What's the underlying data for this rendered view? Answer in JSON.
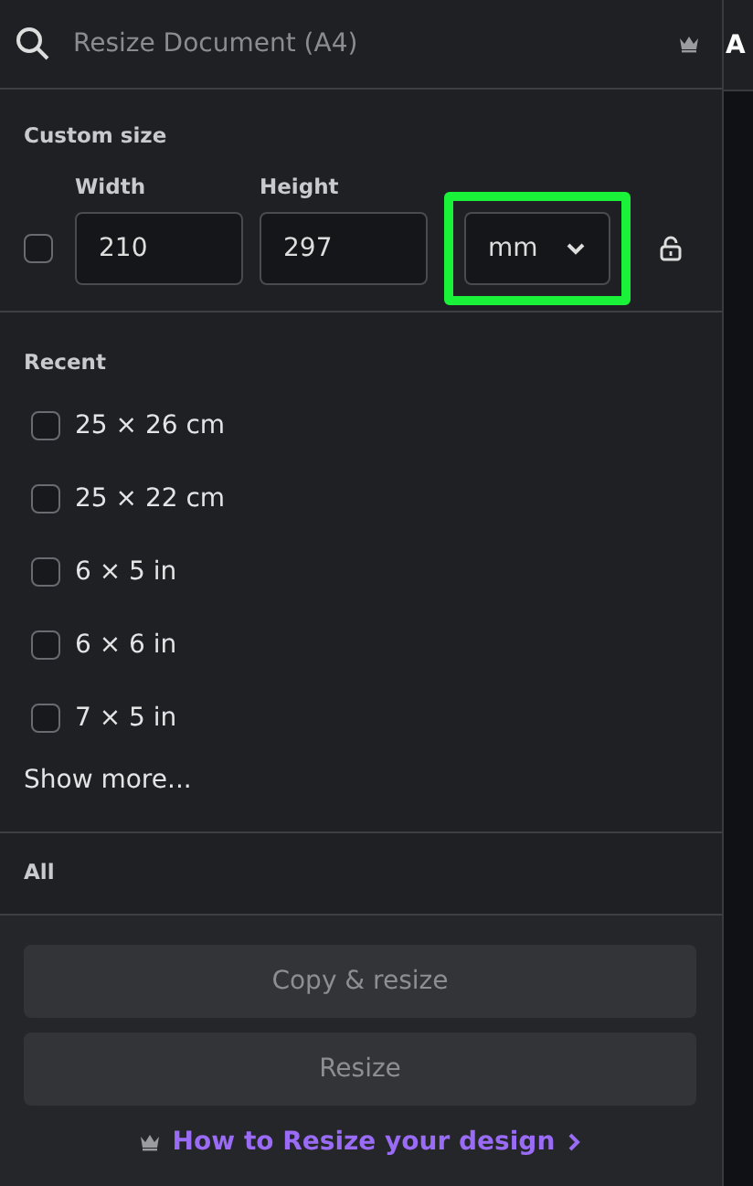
{
  "search": {
    "placeholder": "Resize Document (A4)"
  },
  "custom_size": {
    "title": "Custom size",
    "lock_ratio_checked": false,
    "width": {
      "label": "Width",
      "value": "210"
    },
    "height": {
      "label": "Height",
      "value": "297"
    },
    "unit": {
      "value": "mm",
      "highlighted": true
    },
    "locked": false
  },
  "recent": {
    "title": "Recent",
    "items": [
      {
        "label": "25 × 26 cm",
        "checked": false
      },
      {
        "label": "25 × 22 cm",
        "checked": false
      },
      {
        "label": "6 × 5 in",
        "checked": false
      },
      {
        "label": "6 × 6 in",
        "checked": false
      },
      {
        "label": "7 × 5 in",
        "checked": false
      }
    ],
    "show_more": "Show more..."
  },
  "all": {
    "title": "All"
  },
  "buttons": [
    {
      "label": "Copy & resize",
      "disabled": true
    },
    {
      "label": "Resize",
      "disabled": true
    }
  ],
  "help_link": "How to Resize your design",
  "side_panel": {
    "title": "A"
  }
}
